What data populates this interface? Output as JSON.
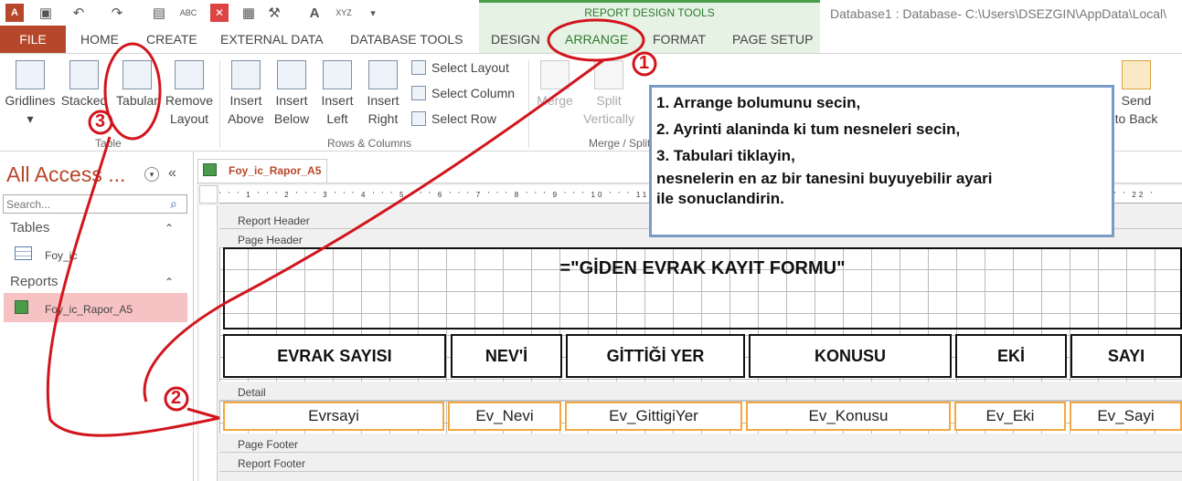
{
  "window_title": "Database1 : Database- C:\\Users\\DSEZGIN\\AppData\\Local\\",
  "context_tab_label": "REPORT DESIGN TOOLS",
  "tabs": {
    "file": "FILE",
    "home": "HOME",
    "create": "CREATE",
    "external": "EXTERNAL DATA",
    "dbtools": "DATABASE TOOLS",
    "design": "DESIGN",
    "arrange": "ARRANGE",
    "format": "FORMAT",
    "pagesetup": "PAGE SETUP"
  },
  "ribbon": {
    "gridlines": "Gridlines",
    "stacked": "Stacked",
    "tabular": "Tabular",
    "remove1": "Remove",
    "remove2": "Layout",
    "insert": "Insert",
    "above": "Above",
    "below": "Below",
    "left": "Left",
    "right": "Right",
    "select_layout": "Select Layout",
    "select_column": "Select Column",
    "select_row": "Select Row",
    "merge": "Merge",
    "split": "Split",
    "vertically": "Vertically",
    "send1": "Send",
    "send2": "to Back",
    "group_table": "Table",
    "group_rows": "Rows & Columns",
    "group_merge": "Merge / Split"
  },
  "nav": {
    "title": "All Access ...",
    "search_placeholder": "Search...",
    "tables_header": "Tables",
    "table_item": "Foy_ic",
    "reports_header": "Reports",
    "report_item": "Foy_ic_Rapor_A5"
  },
  "document_tab": "Foy_ic_Rapor_A5",
  "ruler_text": "' ' ' 1 ' ' ' 2 ' ' ' 3 ' ' ' 4 ' ' ' 5 ' ' ' 6 ' ' ' 7 ' ' ' 8 ' ' ' 9 ' ' ' 10 ' ' ' 11 ' ' ' 12 ' ' ' 13 ' ' ' 14 ' ' ' 15 ' ' ' 16 ' ' ' 17 ' ' ' 18 ' ' ' 19 ' ' ' 20 ' ' ' 21 ' ' ' 22 '",
  "bands": {
    "report_header": "Report Header",
    "page_header": "Page Header",
    "detail": "Detail",
    "page_footer": "Page Footer",
    "report_footer": "Report Footer"
  },
  "report_title": "=\"GİDEN EVRAK KAYIT FORMU\"",
  "headers": [
    "EVRAK SAYISI",
    "NEV'İ",
    "GİTTİĞİ YER",
    "KONUSU",
    "EKİ",
    "SAYI"
  ],
  "fields": [
    "Evrsayi",
    "Ev_Nevi",
    "Ev_GittigiYer",
    "Ev_Konusu",
    "Ev_Eki",
    "Ev_Sayi"
  ],
  "callout": {
    "line1": "1. Arrange bolumunu secin,",
    "line2": "2. Ayrinti alaninda ki tum nesneleri secin,",
    "line3": "3. Tabulari tiklayin,",
    "line4": "nesnelerin en az bir tanesini buyuyebilir ayari",
    "line5": "ile sonuclandirin."
  },
  "markers": {
    "one": "1",
    "two": "2",
    "three": "3"
  },
  "colors": {
    "file_tab": "#b7472a",
    "context": "#4aa04a",
    "annotation": "#d2151d",
    "callout_border": "#7a9bc6",
    "field_border": "#f5a742"
  }
}
